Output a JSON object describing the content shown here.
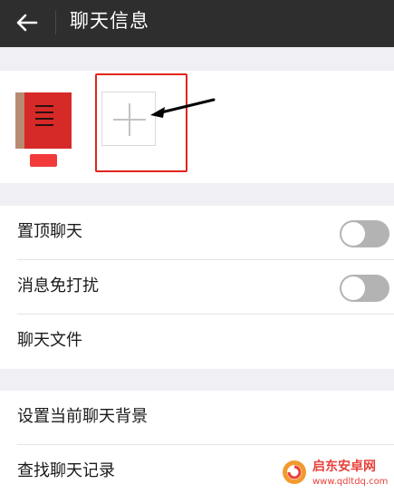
{
  "header": {
    "title": "聊天信息",
    "back_icon": "arrow-left-icon"
  },
  "members": {
    "add_icon": "plus-icon",
    "annotation_color": "#e0261e"
  },
  "settings": {
    "pin_chat": {
      "label": "置顶聊天",
      "enabled": false
    },
    "mute_notifications": {
      "label": "消息免打扰",
      "enabled": false
    },
    "chat_files": {
      "label": "聊天文件"
    },
    "set_background": {
      "label": "设置当前聊天背景"
    },
    "search_history": {
      "label": "查找聊天记录"
    }
  },
  "watermark": {
    "name": "启东安卓网",
    "url": "www.qdltdq.com"
  },
  "colors": {
    "header_bg": "#2e2e2e",
    "page_bg": "#efeff4",
    "toggle_off": "#b3b3b3"
  }
}
